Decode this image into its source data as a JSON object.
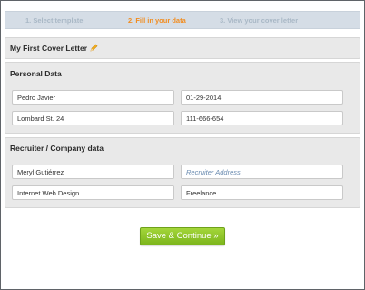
{
  "steps": [
    {
      "label": "1. Select template",
      "state": "inactive"
    },
    {
      "label": "2. Fill in your data",
      "state": "active"
    },
    {
      "label": "3. View your cover letter",
      "state": "inactive"
    }
  ],
  "letter": {
    "title": "My First Cover Letter",
    "edit_icon": "pencil-icon"
  },
  "personal": {
    "title": "Personal Data",
    "name": "Pedro Javier",
    "date": "01-29-2014",
    "address": "Lombard St. 24",
    "phone": "111-666-654"
  },
  "recruiter": {
    "title": "Recruiter / Company data",
    "name": "Meryl Gutiérrez",
    "address_placeholder": "Recruiter Address",
    "company": "Internet Web Design",
    "position": "Freelance"
  },
  "actions": {
    "save_label": "Save & Continue »"
  },
  "colors": {
    "active_step": "#f28c1e",
    "inactive_step": "#a9b8c6",
    "button": "#8cc52a"
  }
}
